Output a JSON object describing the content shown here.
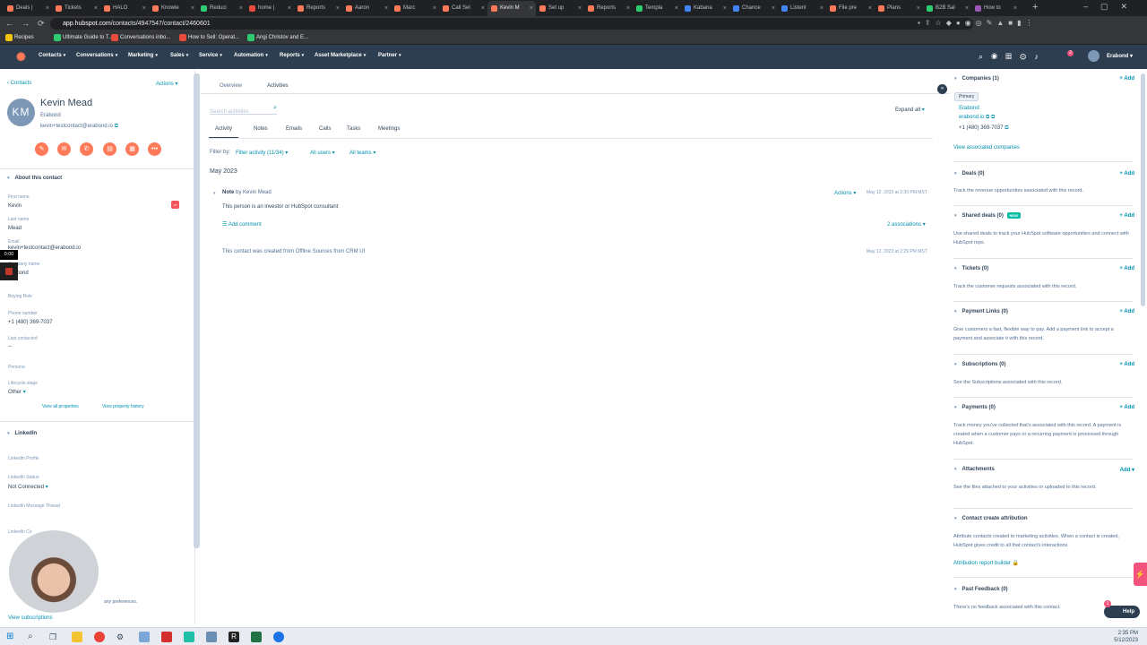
{
  "browser": {
    "tabs": [
      {
        "label": "Deals |",
        "color": "#ff7a59"
      },
      {
        "label": "Tickets",
        "color": "#ff7a59"
      },
      {
        "label": "HALO",
        "color": "#ff7a59"
      },
      {
        "label": "Knowle",
        "color": "#ff7a59"
      },
      {
        "label": "Reduci",
        "color": "#2ecc71"
      },
      {
        "label": "home |",
        "color": "#e74c3c"
      },
      {
        "label": "Reports",
        "color": "#ff7a59"
      },
      {
        "label": "Aaron",
        "color": "#ff7a59"
      },
      {
        "label": "Marc",
        "color": "#ff7a59"
      },
      {
        "label": "Call Sel",
        "color": "#ff7a59"
      },
      {
        "label": "Kevin M",
        "color": "#ff7a59",
        "active": true
      },
      {
        "label": "Set up",
        "color": "#ff7a59"
      },
      {
        "label": "Reports",
        "color": "#ff7a59"
      },
      {
        "label": "Templa",
        "color": "#2ecc71"
      },
      {
        "label": "Kabana",
        "color": "#4285f4"
      },
      {
        "label": "Chance",
        "color": "#4285f4"
      },
      {
        "label": "ListenI",
        "color": "#4285f4"
      },
      {
        "label": "File pre",
        "color": "#ff7a59"
      },
      {
        "label": "Plans",
        "color": "#ff7a59"
      },
      {
        "label": "B2B Sal",
        "color": "#2ecc71"
      },
      {
        "label": "How to",
        "color": "#9b59b6"
      }
    ],
    "url_domain": "app.hubspot.com",
    "url_path": "/contacts/4947547/contact/2460601",
    "bookmarks": [
      {
        "label": "Recipes",
        "color": "#f1c40f"
      },
      {
        "label": "Ultimate Guide to T...",
        "color": "#2ecc71"
      },
      {
        "label": "Conversations inbo...",
        "color": "#e74c3c"
      },
      {
        "label": "How to Sell: Operat...",
        "color": "#e74c3c"
      },
      {
        "label": "Angi Christov and E...",
        "color": "#2ecc71"
      }
    ]
  },
  "nav": {
    "items": [
      "Contacts",
      "Conversations",
      "Marketing",
      "Sales",
      "Service",
      "Automation",
      "Reports",
      "Asset Marketplace",
      "Partner"
    ],
    "account": "Erabond",
    "notif_count": "2"
  },
  "contact": {
    "breadcrumb": "Contacts",
    "actions": "Actions",
    "initials": "KM",
    "name": "Kevin Mead",
    "company": "Erabond",
    "email": "kevin+testcontact@erabond.io",
    "about_title": "About this contact",
    "fields": {
      "first_name_label": "First name",
      "first_name": "Kevin",
      "last_name_label": "Last name",
      "last_name": "Mead",
      "email_label": "Email",
      "email": "kevin+testcontact@erabond.io",
      "company_label": "Company name",
      "company": "Erabond",
      "buying_role_label": "Buying Role",
      "phone_label": "Phone number",
      "phone": "+1 (480) 369-7037",
      "last_contacted_label": "Last contacted",
      "last_contacted": "--",
      "persona_label": "Persona",
      "lifecycle_label": "Lifecycle stage",
      "lifecycle": "Other"
    },
    "view_all": "View all properties",
    "view_history": "View property history",
    "linkedin_title": "LinkedIn",
    "linkedin_profile_label": "LinkedIn Profile",
    "linkedin_status_label": "LinkedIn Status",
    "linkedin_status": "Not Connected",
    "linkedin_thread_label": "LinkedIn Message Thread",
    "linkedin_conn_label": "LinkedIn Co",
    "prefs_text": "any preferences.",
    "view_subscriptions": "View subscriptions",
    "timer": "0:00"
  },
  "main": {
    "tabs": [
      "Overview",
      "Activities"
    ],
    "search_placeholder": "Search activities",
    "expand_all": "Expand all",
    "subtabs": [
      "Activity",
      "Notes",
      "Emails",
      "Calls",
      "Tasks",
      "Meetings"
    ],
    "filter_by": "Filter by:",
    "filter_activity": "Filter activity (11/34)",
    "all_users": "All users",
    "all_teams": "All teams",
    "month": "May 2023",
    "note_label": "Note",
    "note_by": "by Kevin Mead",
    "note_actions": "Actions",
    "note_date": "May 12, 2023 at 2:30 PM MST",
    "note_body": "This person is an investor or HubSpot consultant",
    "add_comment": "Add comment",
    "associations": "2 associations",
    "created_text": "This contact was created from Offline Sources from CRM UI",
    "created_date": "May 12, 2023 at 2:29 PM MST"
  },
  "right": {
    "companies_title": "Companies (1)",
    "add": "+ Add",
    "primary": "Primary",
    "company_name": "Erabond",
    "company_domain": "erabond.io",
    "company_phone": "+1 (480) 369-7037",
    "view_companies": "View associated companies",
    "deals_title": "Deals (0)",
    "deals_desc": "Track the revenue opportunities associated with this record.",
    "shared_title": "Shared deals (0)",
    "new_badge": "NEW",
    "shared_desc": "Use shared deals to track your HubSpot software opportunities and connect with HubSpot reps.",
    "tickets_title": "Tickets (0)",
    "tickets_desc": "Track the customer requests associated with this record.",
    "paylinks_title": "Payment Links (0)",
    "paylinks_desc": "Give customers a fast, flexible way to pay. Add a payment link to accept a payment and associate it with this record.",
    "subs_title": "Subscriptions (0)",
    "subs_desc": "See the Subscriptions associated with this record.",
    "payments_title": "Payments (0)",
    "payments_desc": "Track money you've collected that's associated with this record. A payment is created when a customer pays or a recurring payment is processed through HubSpot.",
    "attach_title": "Attachments",
    "attach_add": "Add",
    "attach_desc": "See the files attached to your activities or uploaded to this record.",
    "attr_title": "Contact create attribution",
    "attr_desc": "Attribute contacts created to marketing activities. When a contact is created, HubSpot gives credit to all that contact's interactions.",
    "attr_link": "Attribution report builder",
    "feedback_title": "Past Feedback (0)",
    "feedback_desc": "There's no feedback associated with this contact."
  },
  "help": {
    "label": "Help",
    "badge": "1"
  },
  "taskbar": {
    "time": "2:35 PM",
    "date": "5/12/2023"
  }
}
